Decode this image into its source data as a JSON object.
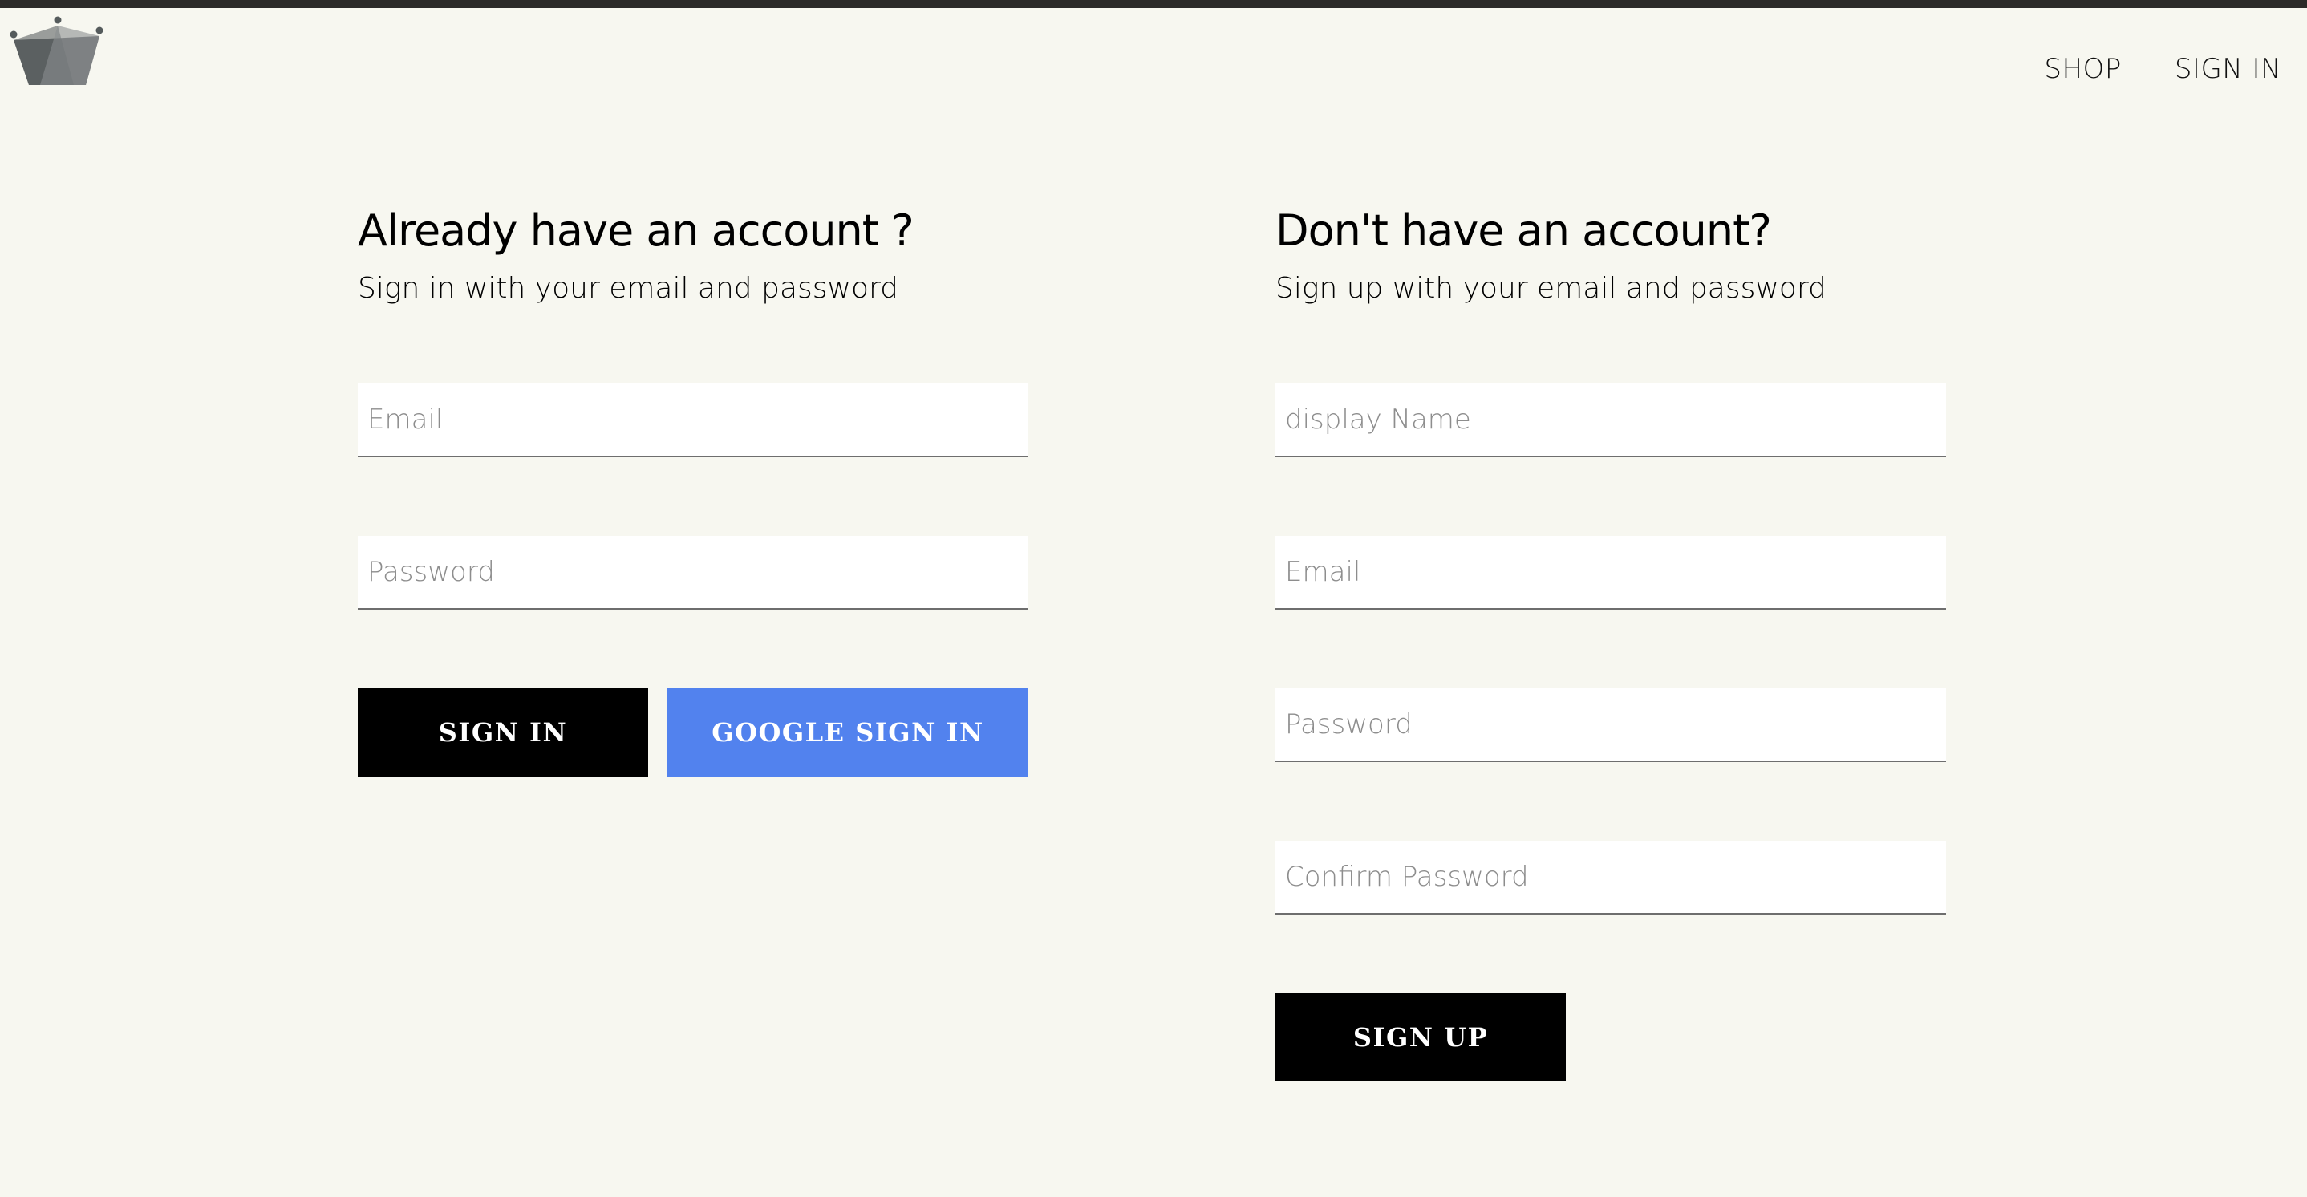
{
  "header": {
    "logo_icon": "crown-icon",
    "nav": {
      "shop_label": "SHOP",
      "sign_in_label": "SIGN IN"
    }
  },
  "sign_in": {
    "title": "Already have an account ?",
    "subtitle": "Sign in with your email and password",
    "email_placeholder": "Email",
    "email_value": "",
    "password_placeholder": "Password",
    "password_value": "",
    "submit_label": "SIGN IN",
    "google_label": "GOOGLE SIGN IN"
  },
  "sign_up": {
    "title": "Don't have an account?",
    "subtitle": "Sign up with your email and password",
    "display_name_placeholder": "display Name",
    "display_name_value": "",
    "email_placeholder": "Email",
    "email_value": "",
    "password_placeholder": "Password",
    "password_value": "",
    "confirm_password_placeholder": "Confirm Password",
    "confirm_password_value": "",
    "submit_label": "SIGN UP"
  },
  "colors": {
    "page_background": "#f7f7f0",
    "top_bar": "#2c2b29",
    "primary_button": "#000000",
    "google_button": "#5282ee",
    "logo_gray": "#6b6f70"
  }
}
